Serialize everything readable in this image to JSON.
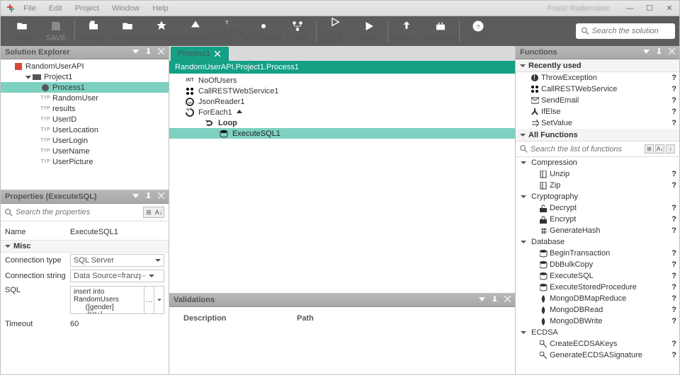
{
  "title_user": "Franz Rademaker",
  "menu": {
    "file": "File",
    "edit": "Edit",
    "project": "Project",
    "window": "Window",
    "help": "Help"
  },
  "ribbon": {
    "open": "OPEN",
    "save": "SAVE",
    "project": "PROJECT",
    "folder": "FOLDER",
    "process": "PROCESS",
    "service": "SERVICE",
    "customtype": "CUSTOM TYPE",
    "settings": "SETTINGS",
    "flow": "FLOW",
    "rundebug": "RUN & DEBUG",
    "run": "RUN",
    "deploy": "DEPLOY",
    "plugins": "PLUGINS",
    "helpb": "HELP",
    "search_ph": "Search the solution"
  },
  "solution": {
    "title": "Solution Explorer",
    "root": "RandomUserAPI",
    "proj": "Project1",
    "process": "Process1",
    "types": [
      "RandomUser",
      "results",
      "UserID",
      "UserLocation",
      "UserLogin",
      "UserName",
      "UserPicture"
    ]
  },
  "props": {
    "title": "Properties (ExecuteSQL)",
    "search_ph": "Search the properties",
    "name_lbl": "Name",
    "name_val": "ExecuteSQL1",
    "misc": "Misc",
    "ct_lbl": "Connection type",
    "ct_val": "SQL Server",
    "cs_lbl": "Connection string",
    "cs_val": "Data Source=franzpc\\sqlexpress;",
    "sql_lbl": "SQL",
    "sql_val": "insert into RandomUsers\n      ([gender]\n      ,[title]",
    "to_lbl": "Timeout",
    "to_val": "60"
  },
  "designer": {
    "tab": "Process1",
    "breadcrumb": "RandomUserAPI.Project1.Process1",
    "nodes": {
      "n1": "NoOfUsers",
      "n2": "CallRESTWebService1",
      "n3": "JsonReader1",
      "n4": "ForEach1",
      "n5": "Loop",
      "n6": "ExecuteSQL1"
    }
  },
  "validations": {
    "title": "Validations",
    "c1": "Description",
    "c2": "Path"
  },
  "functions": {
    "title": "Functions",
    "recently": "Recently used",
    "recent": [
      "ThrowException",
      "CallRESTWebService",
      "SendEmail",
      "IfElse",
      "SetValue"
    ],
    "all": "All Functions",
    "search_ph": "Search the list of functions",
    "cats": {
      "compression": "Compression",
      "comp_items": [
        "Unzip",
        "Zip"
      ],
      "crypto": "Cryptography",
      "crypto_items": [
        "Decrypt",
        "Encrypt",
        "GenerateHash"
      ],
      "database": "Database",
      "db_items": [
        "BeginTransaction",
        "DbBulkCopy",
        "ExecuteSQL",
        "ExecuteStoredProcedure",
        "MongoDBMapReduce",
        "MongoDBRead",
        "MongoDBWrite"
      ],
      "ecdsa": "ECDSA",
      "ecdsa_items": [
        "CreateECDSAKeys",
        "GenerateECDSASignature"
      ]
    }
  }
}
